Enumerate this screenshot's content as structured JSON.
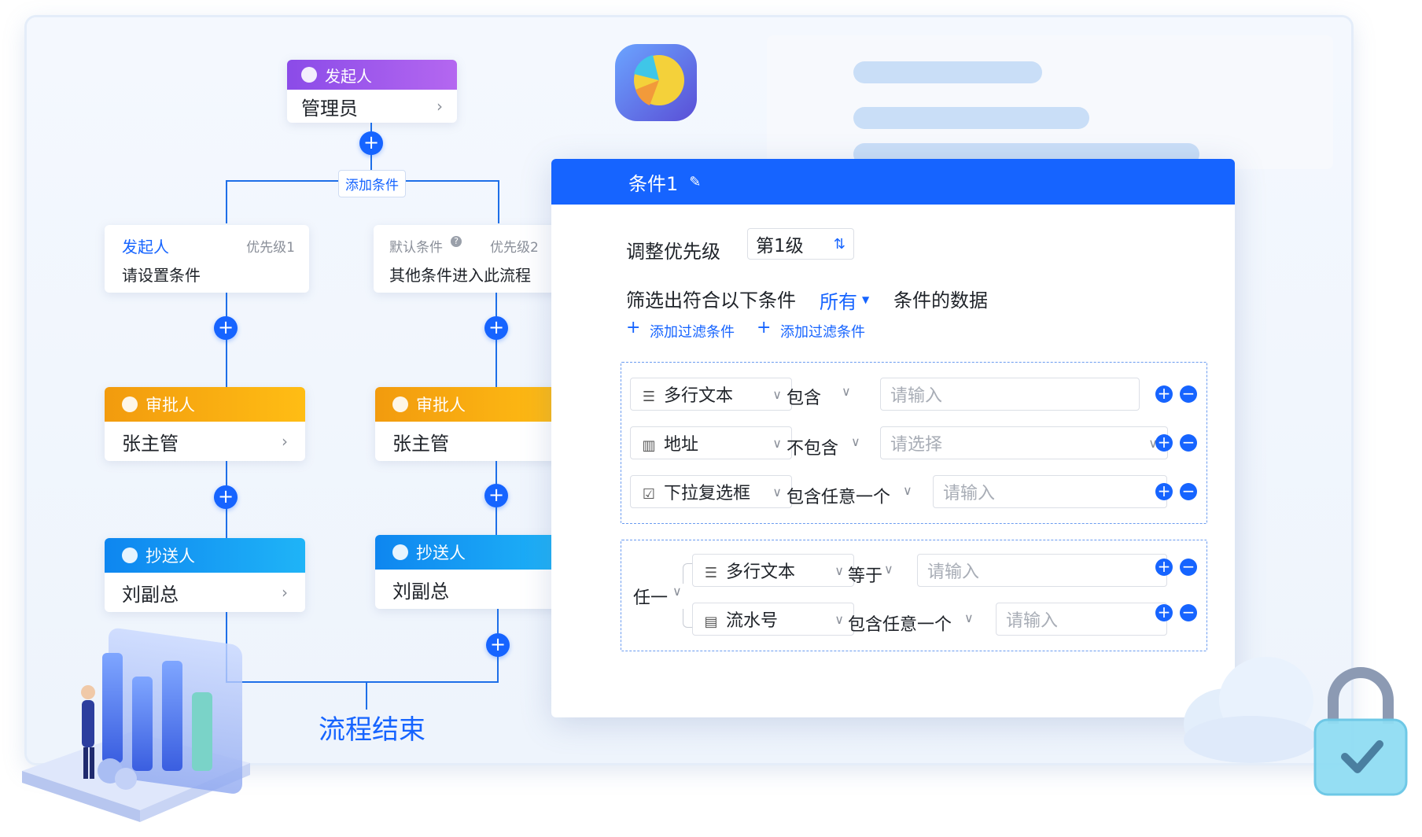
{
  "flow": {
    "initiator": {
      "header": "发起人",
      "value": "管理员"
    },
    "add_condition": "添加条件",
    "branch_left": {
      "condition": {
        "title": "发起人",
        "priority": "优先级1",
        "desc": "请设置条件"
      },
      "approver": {
        "header": "审批人",
        "value": "张主管"
      },
      "cc": {
        "header": "抄送人",
        "value": "刘副总"
      }
    },
    "branch_right": {
      "condition": {
        "title": "默认条件",
        "priority": "优先级2",
        "desc": "其他条件进入此流程"
      },
      "approver": {
        "header": "审批人",
        "value": "张主管"
      },
      "cc": {
        "header": "抄送人",
        "value": "刘副总"
      }
    },
    "end_label": "流程结束",
    "colors": {
      "initiator": "#8b4be8",
      "approver": "#f5a300",
      "cc": "#1aa0f5",
      "accent": "#1664ff"
    }
  },
  "panel": {
    "title": "条件1",
    "priority_label": "调整优先级",
    "priority_value": "第1级",
    "filter_prefix": "筛选出符合以下条件",
    "filter_mode": "所有",
    "filter_suffix": "条件的数据",
    "add_filter_1": "添加过滤条件",
    "add_filter_2": "添加过滤条件",
    "group1": [
      {
        "field": "多行文本",
        "op": "包含",
        "placeholder": "请输入"
      },
      {
        "field": "地址",
        "op": "不包含",
        "placeholder": "请选择"
      },
      {
        "field": "下拉复选框",
        "op": "包含任意一个",
        "placeholder": "请输入"
      }
    ],
    "group2_mode": "任一",
    "group2": [
      {
        "field": "多行文本",
        "op": "等于",
        "placeholder": "请输入"
      },
      {
        "field": "流水号",
        "op": "包含任意一个",
        "placeholder": "请输入"
      }
    ]
  }
}
